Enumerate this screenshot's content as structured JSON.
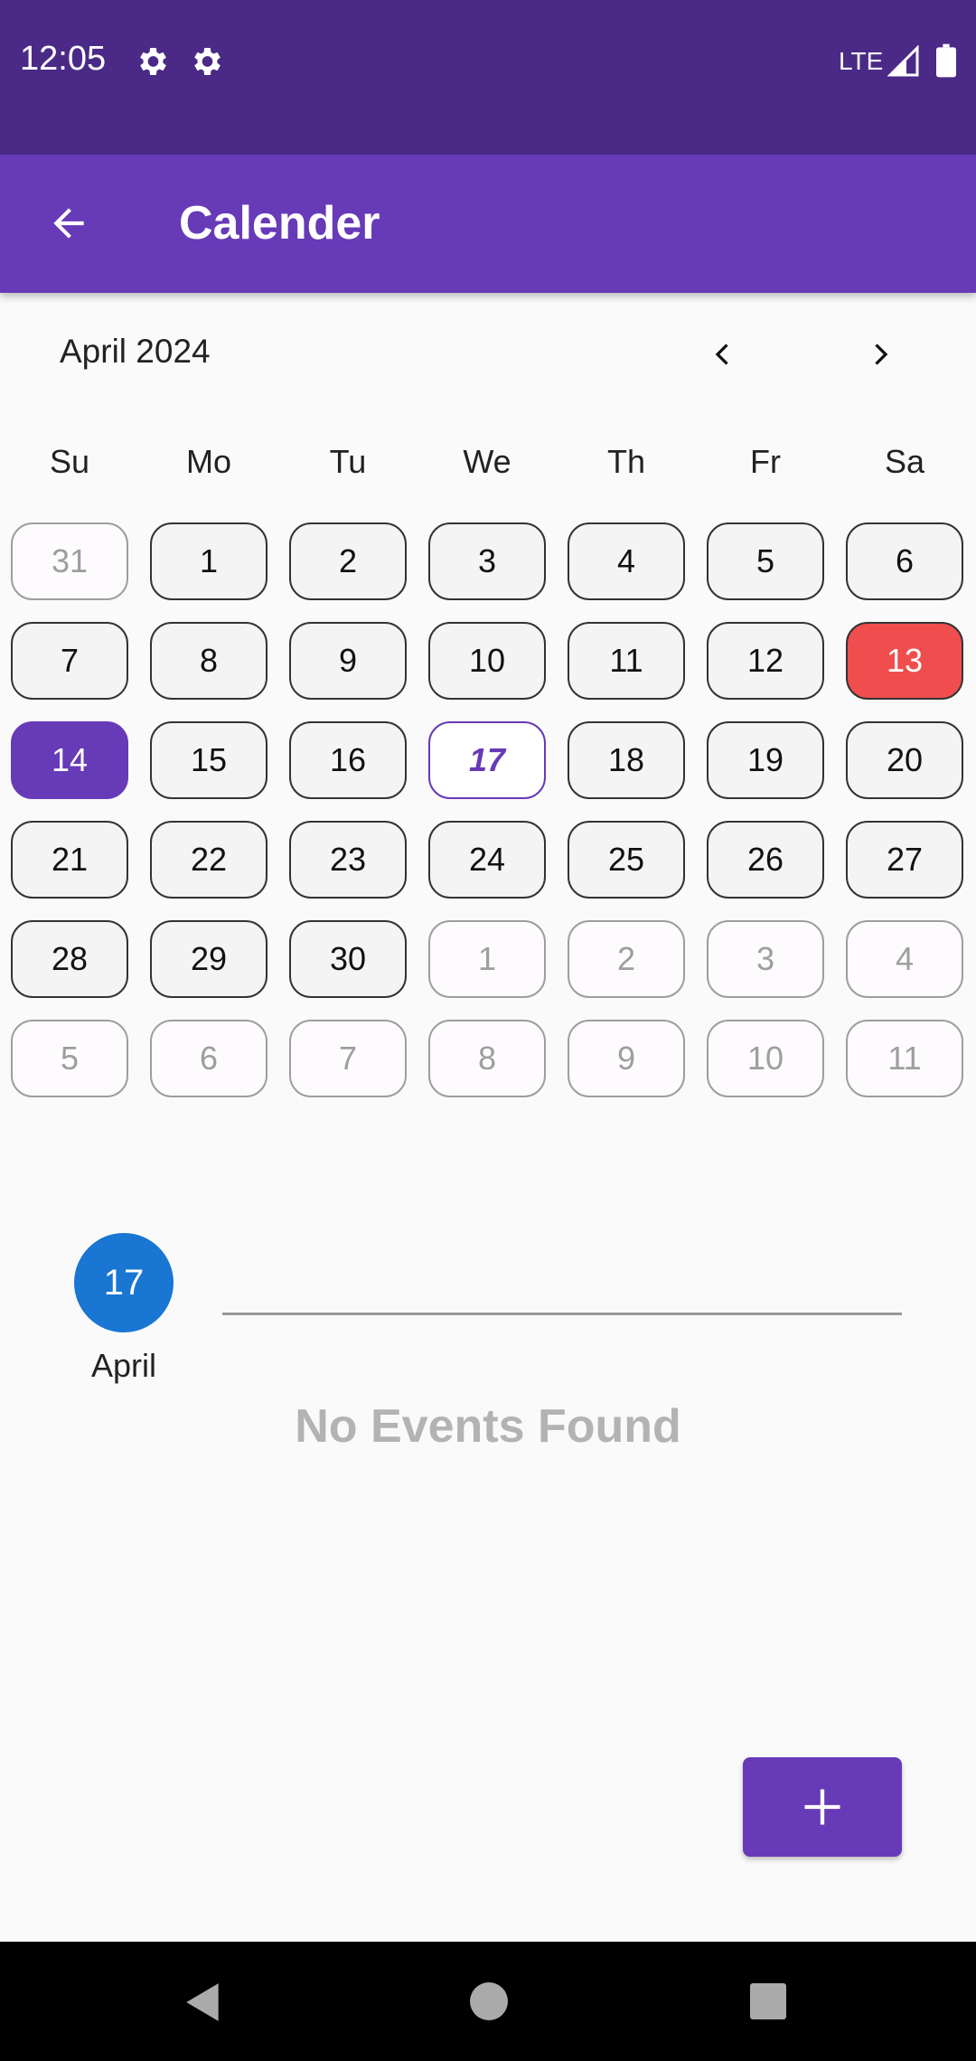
{
  "status_bar": {
    "time": "12:05",
    "network": "LTE"
  },
  "app_bar": {
    "title": "Calender"
  },
  "calendar": {
    "month_label": "April 2024",
    "weekdays": [
      "Su",
      "Mo",
      "Tu",
      "We",
      "Th",
      "Fr",
      "Sa"
    ],
    "days": [
      {
        "label": "31",
        "state": "muted"
      },
      {
        "label": "1",
        "state": "normal"
      },
      {
        "label": "2",
        "state": "normal"
      },
      {
        "label": "3",
        "state": "normal"
      },
      {
        "label": "4",
        "state": "normal"
      },
      {
        "label": "5",
        "state": "normal"
      },
      {
        "label": "6",
        "state": "normal"
      },
      {
        "label": "7",
        "state": "normal"
      },
      {
        "label": "8",
        "state": "normal"
      },
      {
        "label": "9",
        "state": "normal"
      },
      {
        "label": "10",
        "state": "normal"
      },
      {
        "label": "11",
        "state": "normal"
      },
      {
        "label": "12",
        "state": "normal"
      },
      {
        "label": "13",
        "state": "holiday"
      },
      {
        "label": "14",
        "state": "selected"
      },
      {
        "label": "15",
        "state": "normal"
      },
      {
        "label": "16",
        "state": "normal"
      },
      {
        "label": "17",
        "state": "today"
      },
      {
        "label": "18",
        "state": "normal"
      },
      {
        "label": "19",
        "state": "normal"
      },
      {
        "label": "20",
        "state": "normal"
      },
      {
        "label": "21",
        "state": "normal"
      },
      {
        "label": "22",
        "state": "normal"
      },
      {
        "label": "23",
        "state": "normal"
      },
      {
        "label": "24",
        "state": "normal"
      },
      {
        "label": "25",
        "state": "normal"
      },
      {
        "label": "26",
        "state": "normal"
      },
      {
        "label": "27",
        "state": "normal"
      },
      {
        "label": "28",
        "state": "normal"
      },
      {
        "label": "29",
        "state": "normal"
      },
      {
        "label": "30",
        "state": "normal"
      },
      {
        "label": "1",
        "state": "muted"
      },
      {
        "label": "2",
        "state": "muted"
      },
      {
        "label": "3",
        "state": "muted"
      },
      {
        "label": "4",
        "state": "muted"
      },
      {
        "label": "5",
        "state": "muted"
      },
      {
        "label": "6",
        "state": "muted"
      },
      {
        "label": "7",
        "state": "muted"
      },
      {
        "label": "8",
        "state": "muted"
      },
      {
        "label": "9",
        "state": "muted"
      },
      {
        "label": "10",
        "state": "muted"
      },
      {
        "label": "11",
        "state": "muted"
      }
    ]
  },
  "events": {
    "day_number": "17",
    "month": "April",
    "empty_message": "No Events Found"
  },
  "colors": {
    "status_bar": "#4a2a86",
    "app_bar": "#673ab7",
    "selected": "#673ab7",
    "holiday": "#f04e4e",
    "date_circle": "#1976d2"
  },
  "icons": {
    "back": "arrow-left-icon",
    "prev_month": "chevron-left-icon",
    "next_month": "chevron-right-icon",
    "add": "plus-icon"
  }
}
